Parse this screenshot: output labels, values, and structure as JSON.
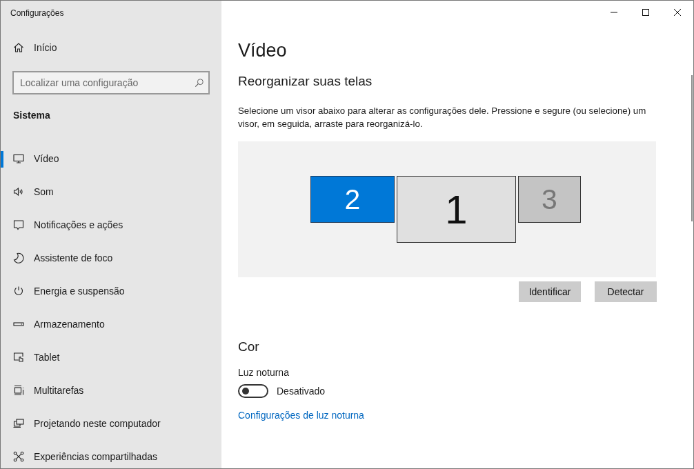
{
  "window": {
    "title": "Configurações"
  },
  "sidebar": {
    "home": "Início",
    "search": {
      "placeholder": "Localizar uma configuração"
    },
    "section": "Sistema",
    "items": [
      {
        "label": "Vídeo",
        "selected": true
      },
      {
        "label": "Som",
        "selected": false
      },
      {
        "label": "Notificações e ações",
        "selected": false
      },
      {
        "label": "Assistente de foco",
        "selected": false
      },
      {
        "label": "Energia e suspensão",
        "selected": false
      },
      {
        "label": "Armazenamento",
        "selected": false
      },
      {
        "label": "Tablet",
        "selected": false
      },
      {
        "label": "Multitarefas",
        "selected": false
      },
      {
        "label": "Projetando neste computador",
        "selected": false
      },
      {
        "label": "Experiências compartilhadas",
        "selected": false
      }
    ]
  },
  "page": {
    "title": "Vídeo",
    "arrange": {
      "heading": "Reorganizar suas telas",
      "description": "Selecione um visor abaixo para alterar as configurações dele. Pressione e segure (ou selecione) um visor, em seguida, arraste para reorganizá-lo.",
      "displays": [
        {
          "number": "2",
          "selected": true,
          "active": true
        },
        {
          "number": "1",
          "selected": false,
          "active": true
        },
        {
          "number": "3",
          "selected": false,
          "active": false
        }
      ],
      "buttons": [
        "Identificar",
        "Detectar"
      ]
    },
    "color": {
      "heading": "Cor",
      "night_light": {
        "label": "Luz noturna",
        "on": false,
        "state_text": "Desativado"
      },
      "link": "Configurações de luz noturna"
    }
  }
}
